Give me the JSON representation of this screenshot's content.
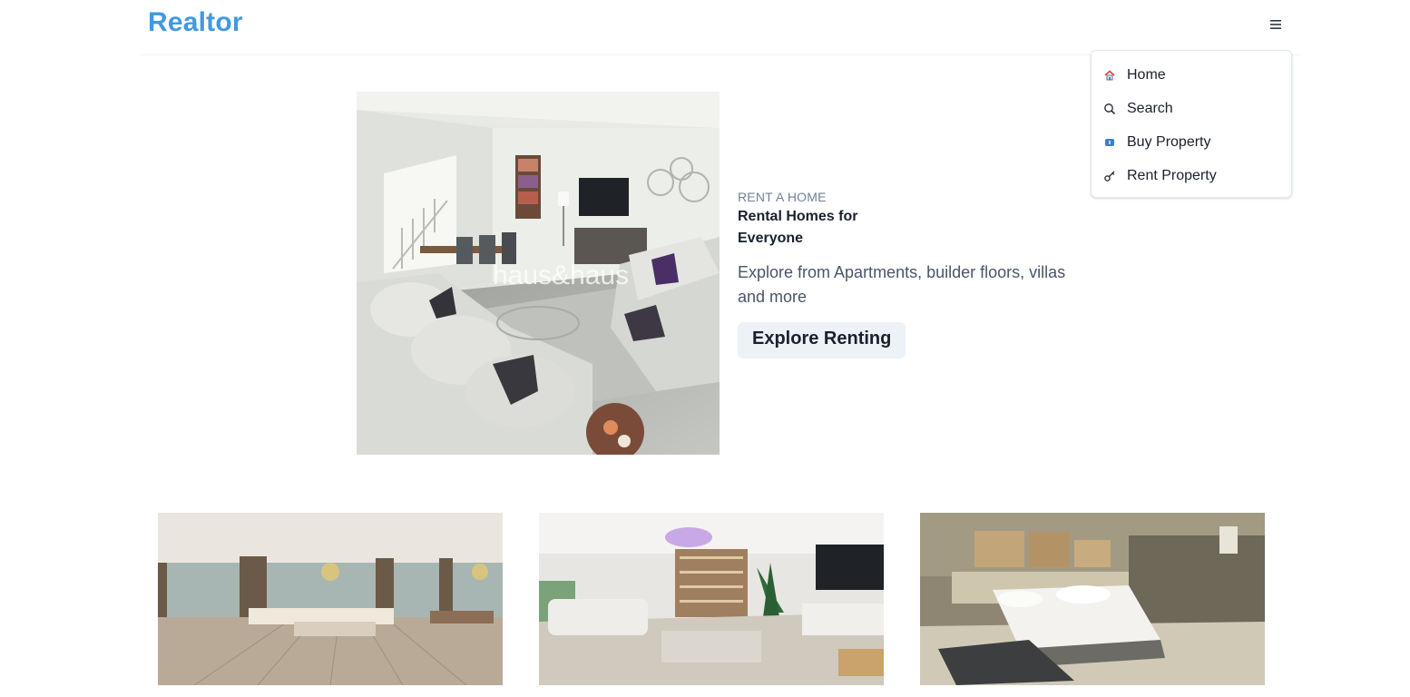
{
  "brand": {
    "name": "Realtor",
    "color": "#4299e1"
  },
  "menu": {
    "icon": "hamburger-menu-icon",
    "items": [
      {
        "label": "Home",
        "icon": "home-icon"
      },
      {
        "label": "Search",
        "icon": "search-icon"
      },
      {
        "label": "Buy Property",
        "icon": "buy-property-icon"
      },
      {
        "label": "Rent Property",
        "icon": "key-icon"
      }
    ]
  },
  "banner": {
    "purpose": "RENT A HOME",
    "title": "Rental Homes for Everyone",
    "desc": "Explore from Apartments, builder floors, villas and more",
    "button": "Explore Renting",
    "image_watermark": "haus&haus"
  },
  "properties": [
    {
      "image": "spacious-living-room-photo"
    },
    {
      "image": "modern-living-room-with-christmas-tree-photo"
    },
    {
      "image": "bedroom-photo"
    }
  ]
}
